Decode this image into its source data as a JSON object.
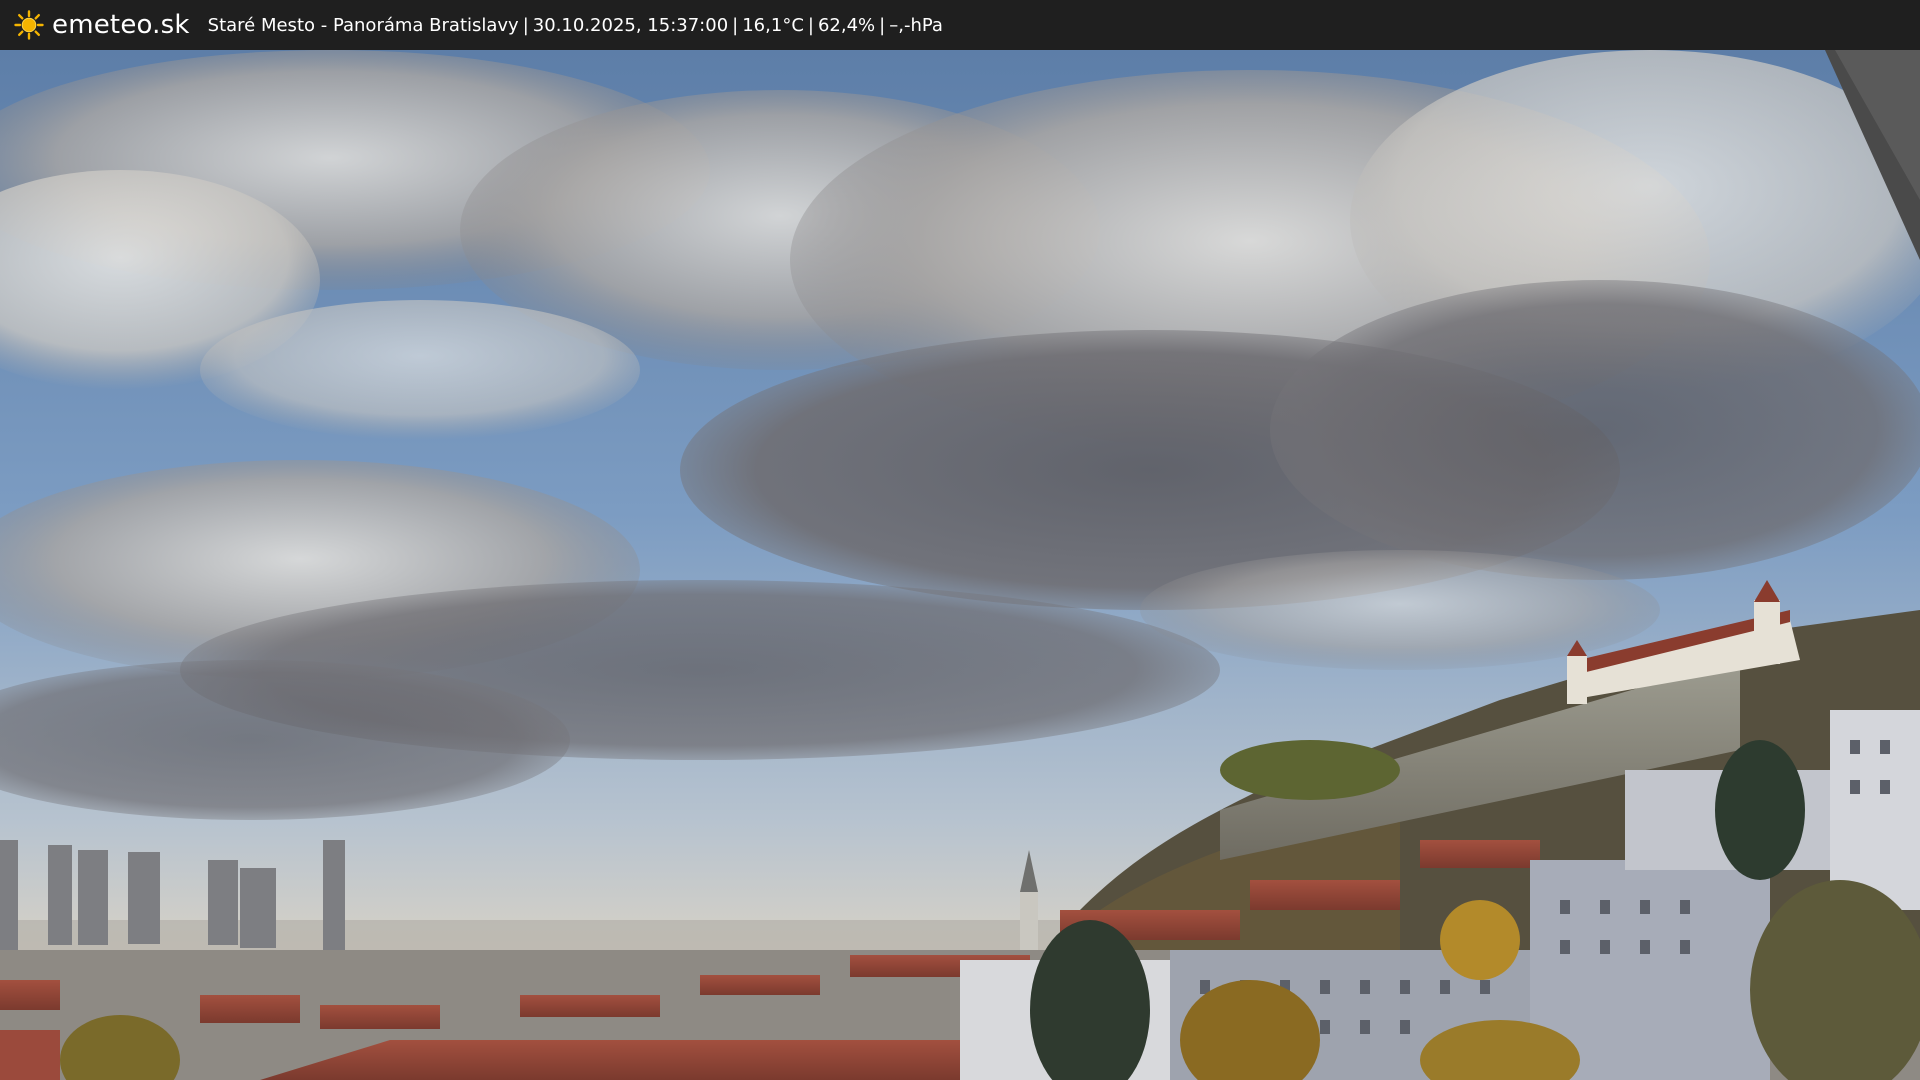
{
  "site": {
    "name": "emeteo.sk",
    "logo_icon": "sun-icon",
    "logo_color": "#f5b400"
  },
  "status": {
    "location": "Staré Mesto - Panoráma Bratislavy",
    "datetime": "30.10.2025, 15:37:00",
    "temperature": "16,1°C",
    "humidity": "62,4%",
    "pressure": "–,-hPa",
    "separator": "|"
  },
  "webcam": {
    "label": "webcam-image",
    "sky_color": "#7a98b8",
    "cloud_color": "#8e8e94",
    "roof_color": "#9b4a3c"
  }
}
